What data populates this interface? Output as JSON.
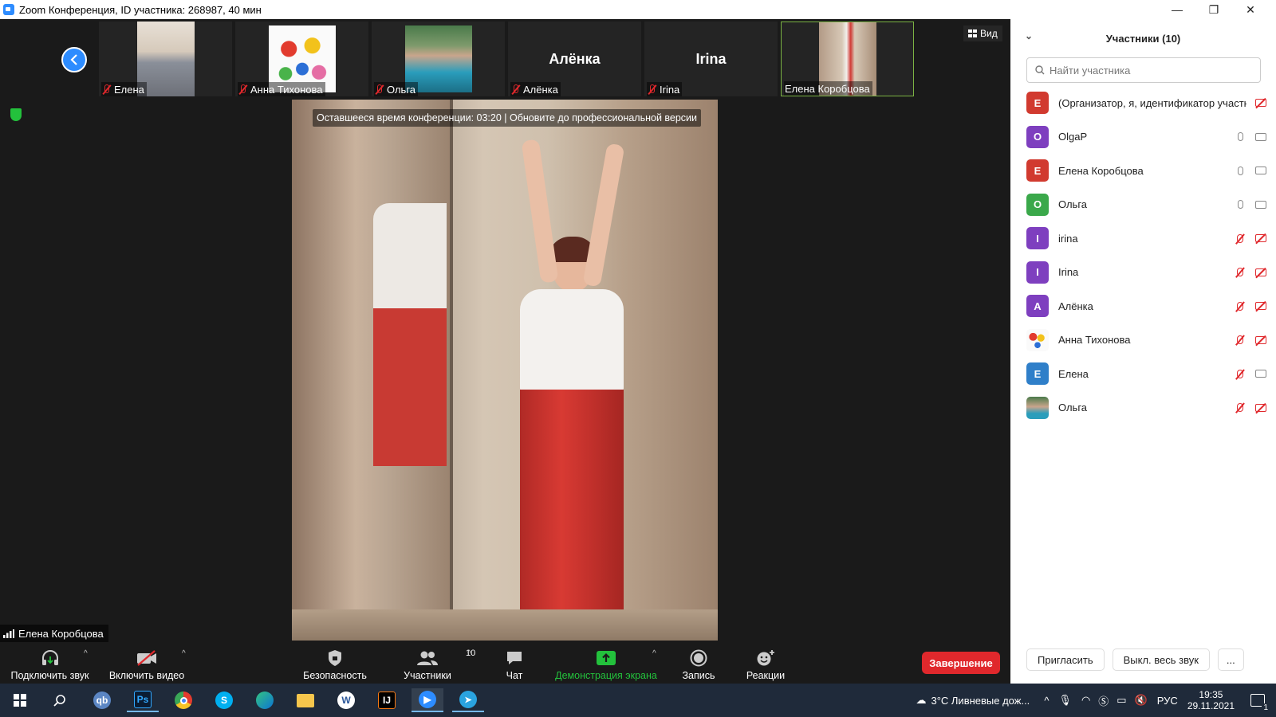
{
  "window": {
    "title": "Zoom Конференция, ID участника: 268987, 40 мин"
  },
  "stage": {
    "view_label": "Вид",
    "time_banner": "Оставшееся время конференции: 03:20 | Обновите до профессиональной версии",
    "active_speaker": "Елена Коробцова"
  },
  "thumbnails": [
    {
      "name": "Елена",
      "muted": true
    },
    {
      "name": "Анна Тихонова",
      "muted": true
    },
    {
      "name": "Ольга",
      "muted": true
    },
    {
      "name": "Алёнка",
      "muted": true,
      "big_name": "Алёнка"
    },
    {
      "name": "Irina",
      "muted": true,
      "big_name": "Irina"
    },
    {
      "name": "Елена Коробцова",
      "muted": false
    }
  ],
  "toolbar": {
    "audio": "Подключить звук",
    "video": "Включить видео",
    "security": "Безопасность",
    "participants": "Участники",
    "participants_count": "10",
    "chat": "Чат",
    "share": "Демонстрация экрана",
    "record": "Запись",
    "reactions": "Реакции",
    "end": "Завершение"
  },
  "panel": {
    "title": "Участники (10)",
    "search_placeholder": "Найти участника",
    "participants": [
      {
        "initial": "Е",
        "color": "#d13a2f",
        "name": "(Организатор, я, идентификатор участника)"
      },
      {
        "initial": "O",
        "color": "#7e3fbf",
        "name": "OlgaP"
      },
      {
        "initial": "Е",
        "color": "#d13a2f",
        "name": "Елена Коробцова"
      },
      {
        "initial": "О",
        "color": "#3aa84a",
        "name": "Ольга"
      },
      {
        "initial": "I",
        "color": "#7e3fbf",
        "name": "irina"
      },
      {
        "initial": "I",
        "color": "#7e3fbf",
        "name": "Irina"
      },
      {
        "initial": "А",
        "color": "#7e3fbf",
        "name": "Алёнка"
      },
      {
        "initial": "",
        "color": "#e8a23a",
        "name": "Анна Тихонова"
      },
      {
        "initial": "Е",
        "color": "#2f7fc9",
        "name": "Елена"
      },
      {
        "initial": "",
        "color": "#2a7f8a",
        "name": "Ольга"
      }
    ],
    "invite": "Пригласить",
    "mute_all": "Выкл. весь звук",
    "more": "..."
  },
  "taskbar": {
    "weather": "3°C  Ливневые дож...",
    "lang": "РУС",
    "time": "19:35",
    "date": "29.11.2021",
    "notif_count": "1"
  }
}
